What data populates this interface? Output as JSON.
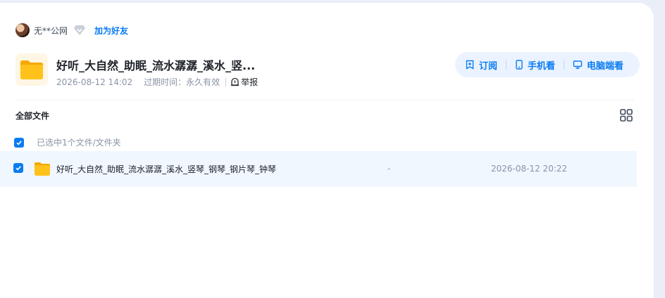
{
  "user": {
    "name": "无**公网",
    "add_friend": "加为好友"
  },
  "share": {
    "title": "好听_大自然_助眠_流水潺潺_溪水_竖...",
    "date": "2026-08-12 14:02",
    "expire_label": "过期时间：",
    "expire_value": "永久有效",
    "report": "举报"
  },
  "actions": {
    "subscribe": "订阅",
    "mobile": "手机看",
    "desktop": "电脑端看"
  },
  "list": {
    "header": "全部文件",
    "selected_text": "已选中1个文件/文件夹",
    "files": [
      {
        "name": "好听_大自然_助眠_流水潺潺_溪水_竖琴_钢琴_钢片琴_钟琴",
        "size": "-",
        "date": "2026-08-12 20:22"
      }
    ]
  },
  "colors": {
    "accent": "#0a7cf3",
    "pill_bg": "#eaf3ff",
    "row_bg": "#f0f7ff",
    "folder": "#ffc21a"
  }
}
